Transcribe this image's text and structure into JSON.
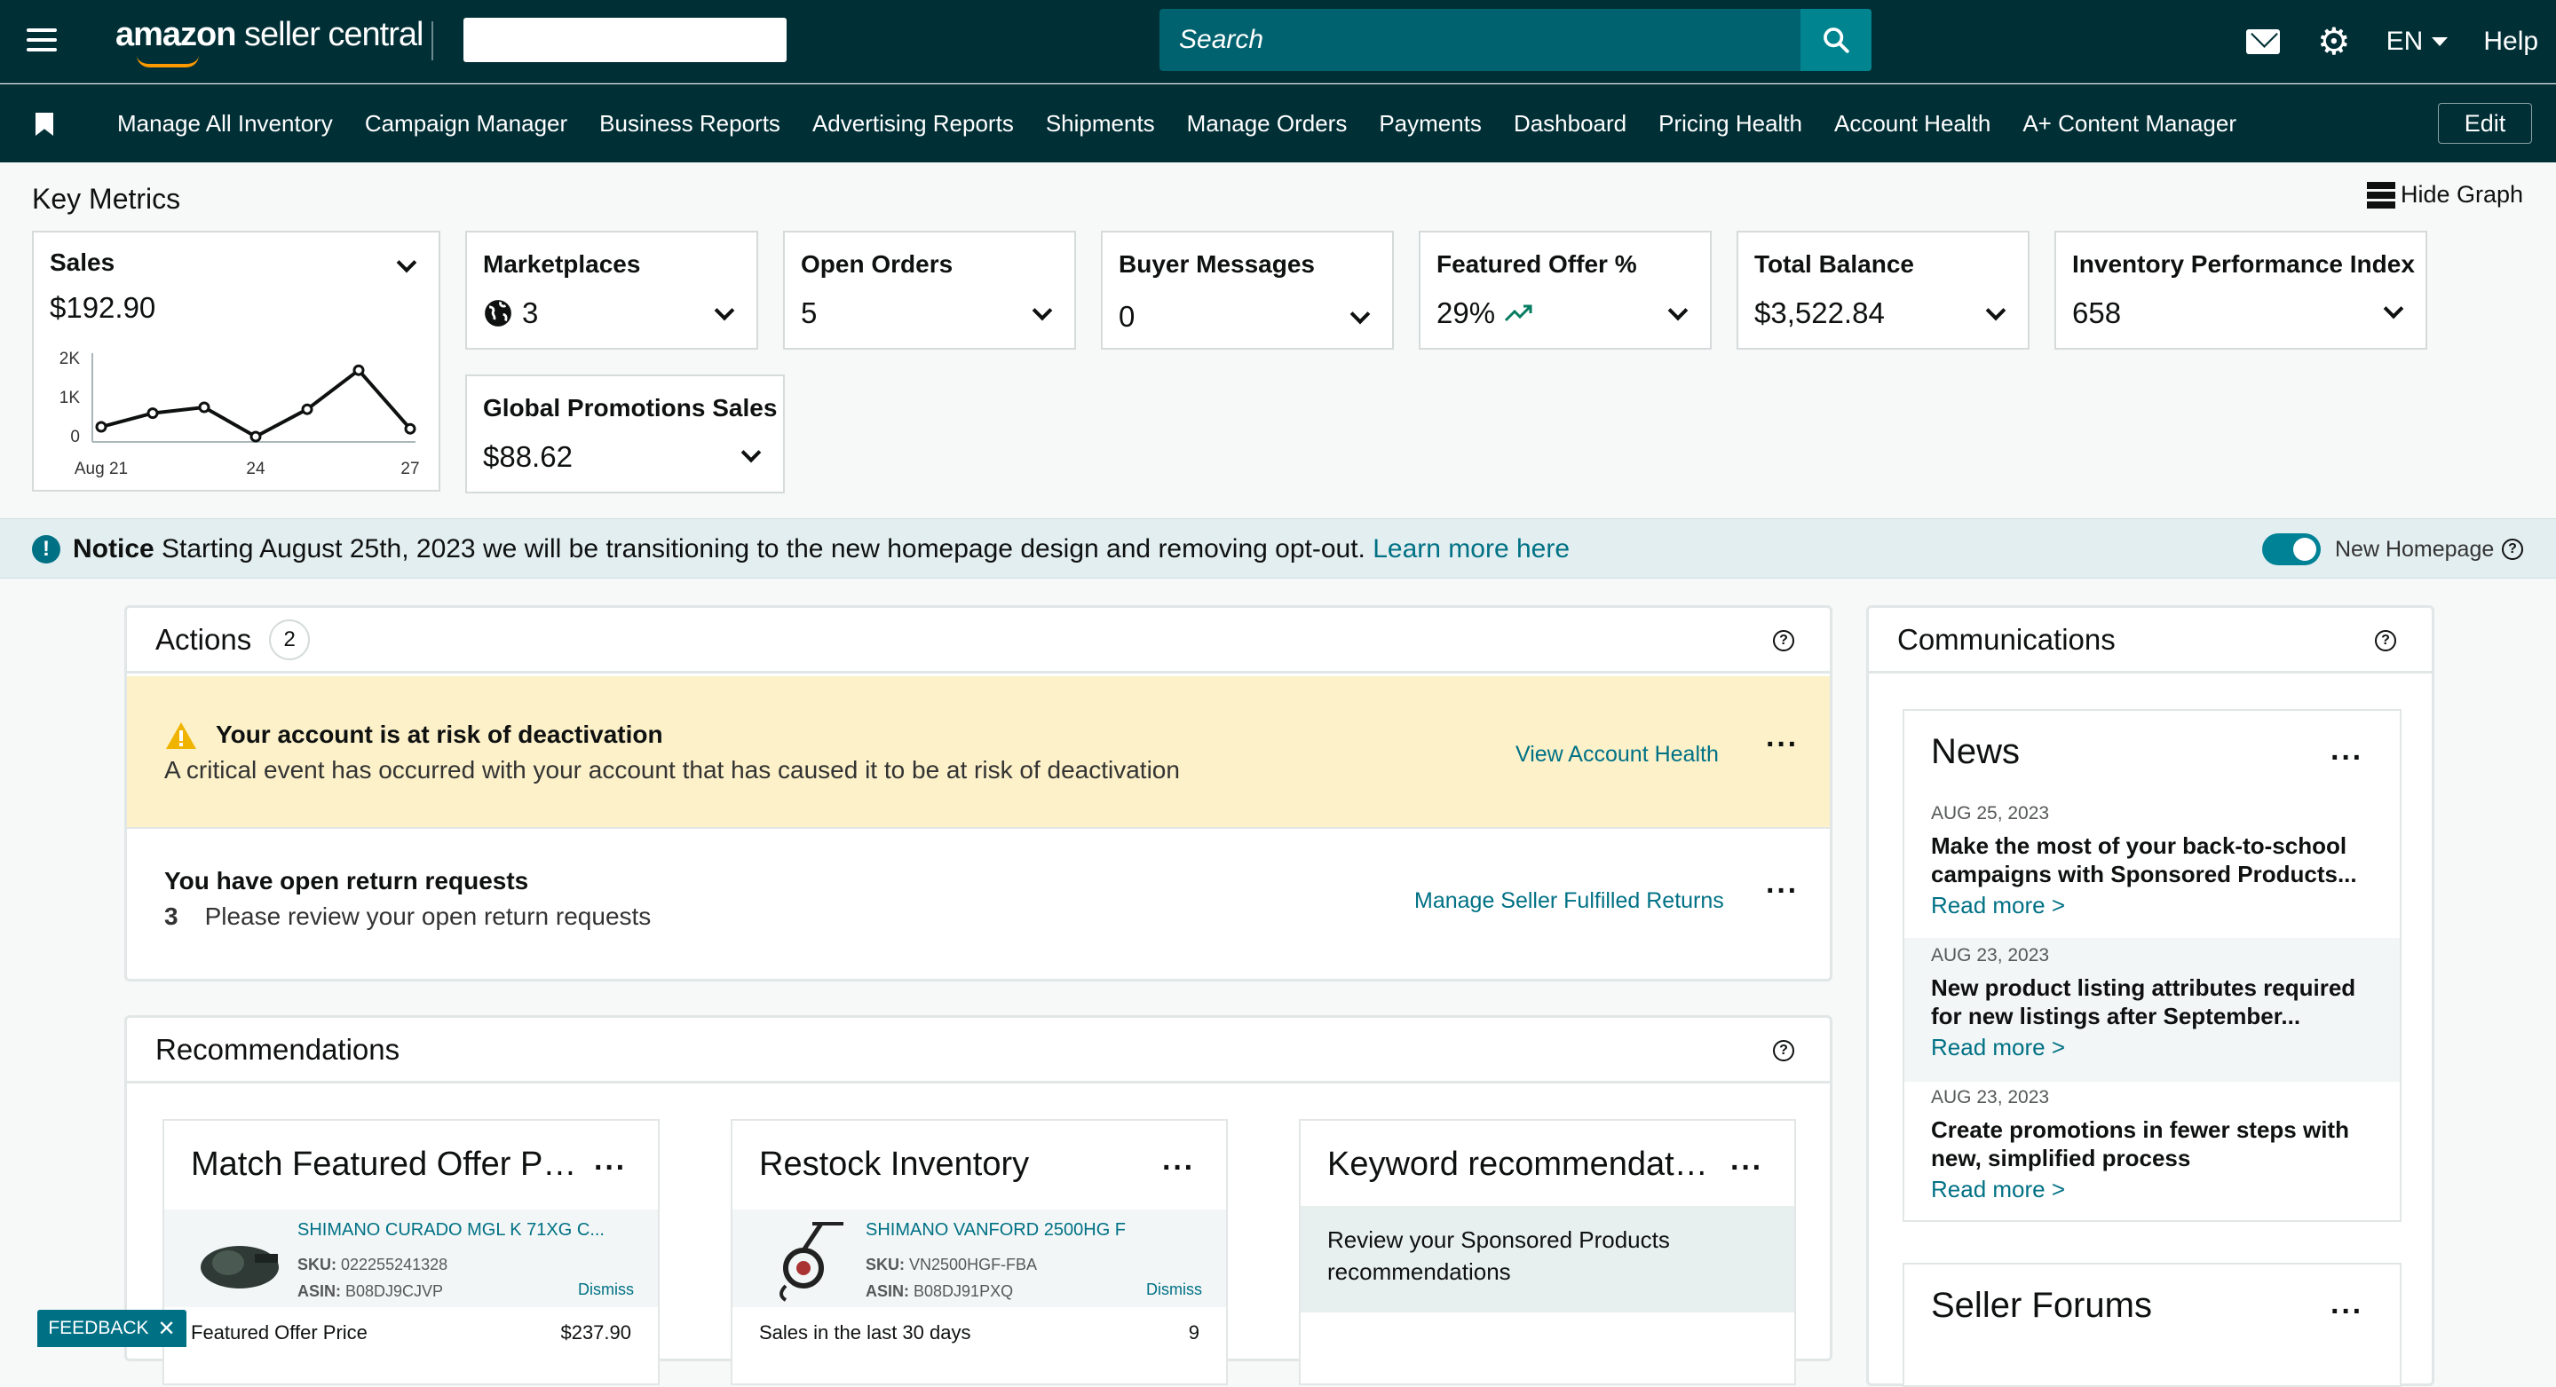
{
  "header": {
    "logo_text_1": "amazon",
    "logo_text_2": " seller central",
    "search_placeholder": "Search",
    "language": "EN",
    "help": "Help"
  },
  "nav": {
    "items": [
      "Manage All Inventory",
      "Campaign Manager",
      "Business Reports",
      "Advertising Reports",
      "Shipments",
      "Manage Orders",
      "Payments",
      "Dashboard",
      "Pricing Health",
      "Account Health",
      "A+ Content Manager"
    ],
    "edit": "Edit"
  },
  "metrics": {
    "title": "Key Metrics",
    "hide_graph": "Hide Graph",
    "sales": {
      "label": "Sales",
      "value": "$192.90"
    },
    "marketplaces": {
      "label": "Marketplaces",
      "value": "3"
    },
    "open_orders": {
      "label": "Open Orders",
      "value": "5"
    },
    "buyer_messages": {
      "label": "Buyer Messages",
      "value": "0"
    },
    "featured_offer": {
      "label": "Featured Offer %",
      "value": "29%"
    },
    "total_balance": {
      "label": "Total Balance",
      "value": "$3,522.84"
    },
    "ipi": {
      "label": "Inventory Performance Index",
      "value": "658"
    },
    "global_promotions": {
      "label": "Global Promotions Sales",
      "value": "$88.62"
    }
  },
  "chart_data": {
    "type": "line",
    "title": "",
    "x": [
      21,
      22,
      23,
      24,
      25,
      26,
      27
    ],
    "x_tick_labels": [
      "Aug 21",
      "24",
      "27"
    ],
    "y_tick_labels": [
      "2K",
      "1K",
      "0"
    ],
    "values": [
      250,
      600,
      750,
      0,
      700,
      1700,
      200
    ],
    "ylim": [
      0,
      2000
    ],
    "colors": {
      "line": "#0f1111"
    }
  },
  "notice": {
    "bold": "Notice",
    "text": " Starting August 25th, 2023 we will be transitioning to the new homepage design and removing opt-out. ",
    "link": "Learn more here",
    "toggle_label": "New Homepage"
  },
  "actions": {
    "title": "Actions",
    "count": "2",
    "alert": {
      "title": "Your account is at risk of deactivation",
      "text": "A critical event has occurred with your account that has caused it to be at risk of deactivation",
      "link": "View Account Health"
    },
    "returns": {
      "title": "You have open return requests",
      "count": "3",
      "text": "Please review your open return requests",
      "link": "Manage Seller Fulfilled Returns"
    }
  },
  "recommendations": {
    "title": "Recommendations",
    "cards": [
      {
        "title": "Match Featured Offer P…",
        "product": "SHIMANO CURADO MGL K 71XG C...",
        "sku_label": "SKU:",
        "sku": "022255241328",
        "asin_label": "ASIN:",
        "asin": "B08DJ9CJVP",
        "dismiss": "Dismiss",
        "metric_label": "Featured Offer Price",
        "metric_value": "$237.90"
      },
      {
        "title": "Restock Inventory",
        "product": "SHIMANO VANFORD 2500HG F",
        "sku_label": "SKU:",
        "sku": "VN2500HGF-FBA",
        "asin_label": "ASIN:",
        "asin": "B08DJ91PXQ",
        "dismiss": "Dismiss",
        "metric_label": "Sales in the last 30 days",
        "metric_value": "9"
      },
      {
        "title": "Keyword recommendat…",
        "text": "Review your Sponsored Products recommendations"
      }
    ]
  },
  "communications": {
    "title": "Communications",
    "news": {
      "title": "News",
      "items": [
        {
          "date": "AUG 25, 2023",
          "title": "Make the most of your back-to-school campaigns with Sponsored Products...",
          "more": "Read more >"
        },
        {
          "date": "AUG 23, 2023",
          "title": "New product listing attributes required for new listings after September...",
          "more": "Read more >"
        },
        {
          "date": "AUG 23, 2023",
          "title": "Create promotions in fewer steps with new, simplified process",
          "more": "Read more >"
        }
      ]
    },
    "forums_title": "Seller Forums"
  },
  "feedback": "FEEDBACK"
}
